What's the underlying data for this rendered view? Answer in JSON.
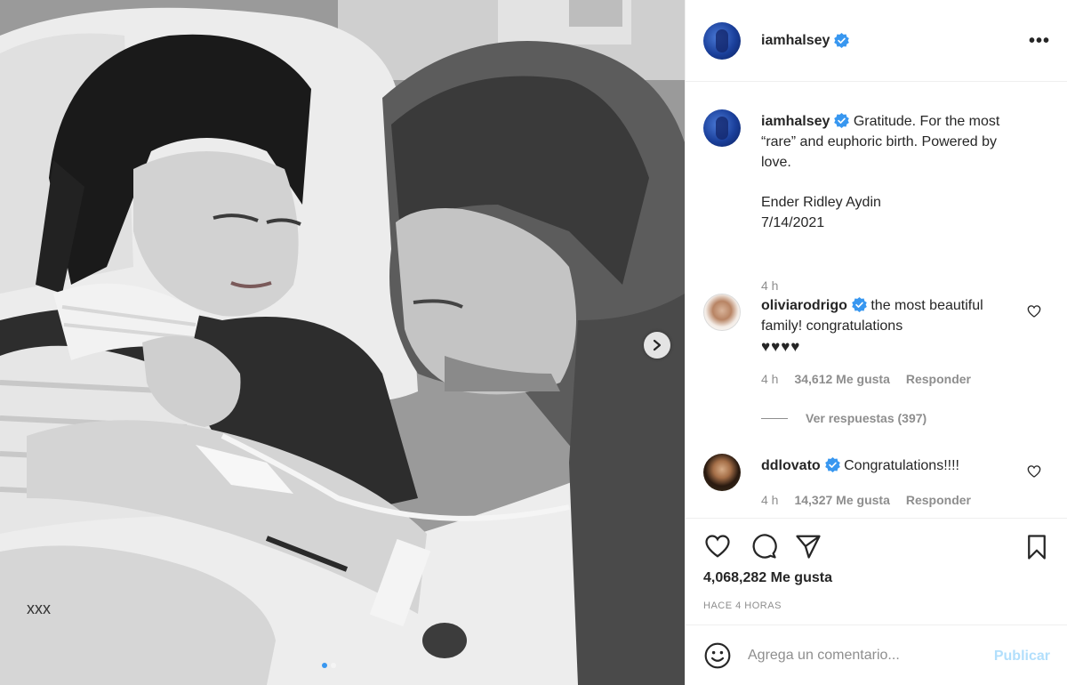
{
  "post": {
    "author": "iamhalsey",
    "more_label": "•••"
  },
  "caption": {
    "author": "iamhalsey",
    "text": "Gratitude. For the most “rare” and euphoric birth. Powered by love.",
    "line2": "Ender Ridley Aydin",
    "line3": "7/14/2021",
    "time": "4 h"
  },
  "comments": [
    {
      "author": "oliviarodrigo",
      "text": "the most beautiful family! congratulations",
      "emoji": "♥♥♥♥",
      "time": "4 h",
      "likes": "34,612 Me gusta",
      "reply": "Responder"
    },
    {
      "author": "ddlovato",
      "text": "Congratulations!!!!",
      "time": "4 h",
      "likes": "14,327 Me gusta",
      "reply": "Responder"
    }
  ],
  "view_replies": "Ver respuestas (397)",
  "actions": {
    "likes": "4,068,282 Me gusta",
    "time_ago": "HACE 4 HORAS"
  },
  "add_comment": {
    "placeholder": "Agrega un comentario...",
    "publish": "Publicar"
  },
  "carousel": {
    "total": 2,
    "current": 1
  },
  "colors": {
    "verified": "#3897f0",
    "publish_disabled": "#b2dffc",
    "muted": "#8e8e8e"
  }
}
